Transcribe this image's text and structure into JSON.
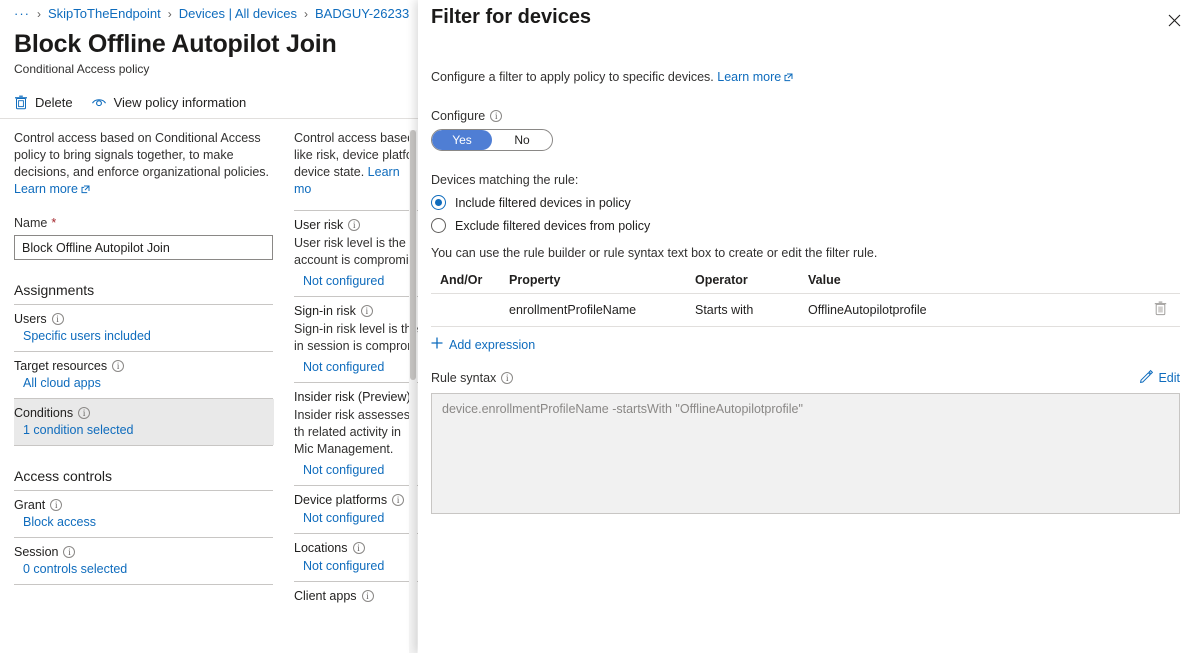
{
  "breadcrumb": {
    "ellipsis": "···",
    "separator": "›",
    "items": [
      {
        "label": "SkipToTheEndpoint"
      },
      {
        "label": "Devices | All devices"
      },
      {
        "label": "BADGUY-26233"
      }
    ]
  },
  "page": {
    "title": "Block Offline Autopilot Join",
    "title_more": "···",
    "subtitle": "Conditional Access policy"
  },
  "commandbar": {
    "delete_label": "Delete",
    "view_policy_label": "View policy information"
  },
  "policy": {
    "description": "Control access based on Conditional Access policy to bring signals together, to make decisions, and enforce organizational policies.",
    "learn_more": "Learn more",
    "name_label": "Name",
    "name_required": "*",
    "name_value": "Block Offline Autopilot Join",
    "assignments_header": "Assignments",
    "access_controls_header": "Access controls",
    "groups": [
      {
        "title": "Users",
        "value": "Specific users included",
        "selected": false
      },
      {
        "title": "Target resources",
        "value": "All cloud apps",
        "selected": false
      },
      {
        "title": "Conditions",
        "value": "1 condition selected",
        "selected": true
      }
    ],
    "access_groups": [
      {
        "title": "Grant",
        "value": "Block access",
        "selected": false
      },
      {
        "title": "Session",
        "value": "0 controls selected",
        "selected": false
      }
    ]
  },
  "conditions_column": {
    "description_clipped": "Control access based like risk, device platfo device state.",
    "learn_more_clipped": "Learn mo",
    "items": [
      {
        "title": "User risk",
        "has_info": true,
        "description": "User risk level is the li account is compromis",
        "value": "Not configured"
      },
      {
        "title": "Sign-in risk",
        "has_info": true,
        "description": "Sign-in risk level is the in session is comprom",
        "value": "Not configured"
      },
      {
        "title": "Insider risk (Preview)",
        "has_info": false,
        "description": "Insider risk assesses th related activity in Mic Management.",
        "value": "Not configured"
      },
      {
        "title": "Device platforms",
        "has_info": true,
        "description": "",
        "value": "Not configured"
      },
      {
        "title": "Locations",
        "has_info": true,
        "description": "",
        "value": "Not configured"
      },
      {
        "title": "Client apps",
        "has_info": true,
        "description": "",
        "value": ""
      }
    ]
  },
  "flyout": {
    "title": "Filter for devices",
    "close_label": "Close",
    "description": "Configure a filter to apply policy to specific devices.",
    "learn_more": "Learn more",
    "configure_label": "Configure",
    "toggle": {
      "yes_label": "Yes",
      "no_label": "No",
      "selected": "Yes"
    },
    "matching_label": "Devices matching the rule:",
    "radios": [
      {
        "label": "Include filtered devices in policy",
        "selected": true
      },
      {
        "label": "Exclude filtered devices from policy",
        "selected": false
      }
    ],
    "builder_hint": "You can use the rule builder or rule syntax text box to create or edit the filter rule.",
    "table": {
      "columns": [
        "And/Or",
        "Property",
        "Operator",
        "Value"
      ],
      "rows": [
        {
          "andor": "",
          "property": "enrollmentProfileName",
          "operator": "Starts with",
          "value": "OfflineAutopilotprofile"
        }
      ]
    },
    "add_expression_label": "Add expression",
    "rule_syntax_label": "Rule syntax",
    "edit_label": "Edit",
    "rule_syntax_value": "device.enrollmentProfileName -startsWith \"OfflineAutopilotprofile\""
  },
  "colors": {
    "link": "#0f6cbd",
    "toggle_on": "#4f7ed4",
    "required": "#a4262c",
    "selected_row": "#e9e9e9"
  }
}
